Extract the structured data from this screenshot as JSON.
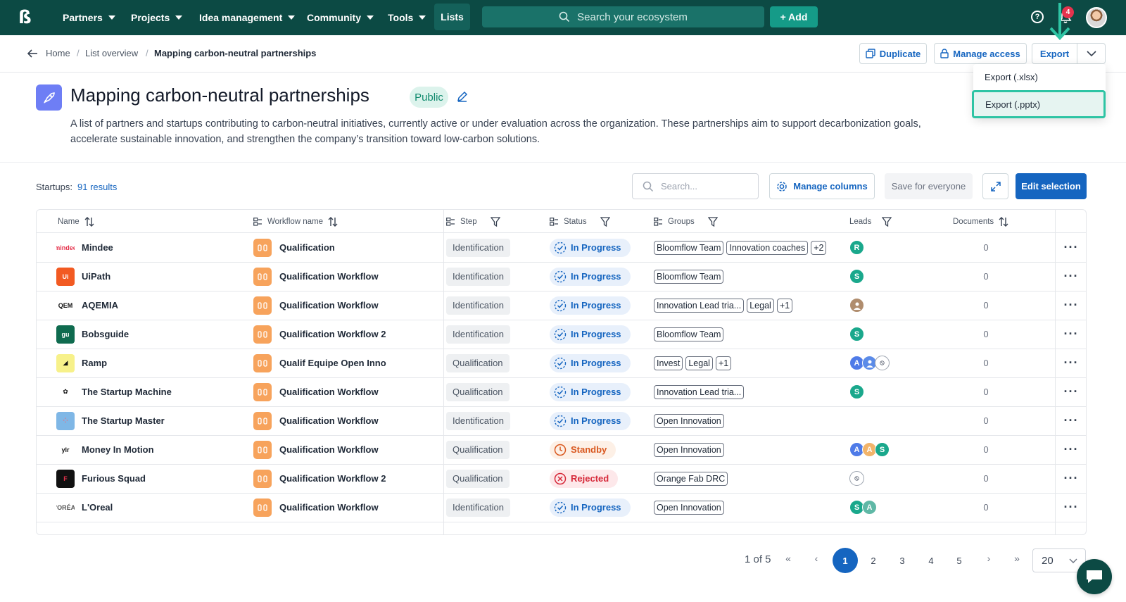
{
  "nav": {
    "items": [
      "Partners",
      "Projects",
      "Idea management",
      "Community",
      "Tools"
    ],
    "lists": "Lists",
    "search_placeholder": "Search your ecosystem",
    "add": "+ Add",
    "notifications_count": "4"
  },
  "breadcrumb": {
    "home": "Home",
    "overview": "List overview",
    "current": "Mapping carbon-neutral partnerships"
  },
  "actions": {
    "duplicate": "Duplicate",
    "manage_access": "Manage access",
    "export": "Export",
    "export_options": [
      "Export (.xlsx)",
      "Export (.pptx)"
    ]
  },
  "list": {
    "title": "Mapping carbon-neutral partnerships",
    "visibility": "Public",
    "description": "A list of partners and startups contributing to carbon-neutral initiatives, currently active or under evaluation across the organization. These partnerships aim to support decarbonization goals, accelerate sustainable innovation, and strengthen the company’s transition toward low-carbon solutions."
  },
  "toolbar": {
    "results_label": "Startups:",
    "results_count": "91 results",
    "search_placeholder": "Search...",
    "manage_columns": "Manage columns",
    "save_everyone": "Save for everyone",
    "edit_selection": "Edit selection"
  },
  "columns": [
    "Name",
    "Workflow name",
    "Step",
    "Status",
    "Groups",
    "Leads",
    "Documents"
  ],
  "rows": [
    {
      "name": "Mindee",
      "workflow": "Qualification",
      "step": "Identification",
      "status": "In Progress",
      "status_type": "progress",
      "groups": [
        "Bloomflow Team",
        "Innovation coaches",
        "+2"
      ],
      "leads": [
        {
          "t": "R",
          "c": "#1aa88c"
        }
      ],
      "docs": "0",
      "logo_text": "mindee",
      "logo_bg": "#ffffff",
      "logo_fg": "#e5334d"
    },
    {
      "name": "UiPath",
      "workflow": "Qualification Workflow",
      "step": "Identification",
      "status": "In Progress",
      "status_type": "progress",
      "groups": [
        "Bloomflow Team"
      ],
      "leads": [
        {
          "t": "S",
          "c": "#1aa88c"
        }
      ],
      "docs": "0",
      "logo_text": "Ui",
      "logo_bg": "#f25a22",
      "logo_fg": "#ffffff"
    },
    {
      "name": "AQEMIA",
      "workflow": "Qualification Workflow",
      "step": "Identification",
      "status": "In Progress",
      "status_type": "progress",
      "groups": [
        "Innovation Lead tria...",
        "Legal",
        "+1"
      ],
      "leads": [
        {
          "t": "",
          "c": "#b08d6e"
        }
      ],
      "docs": "0",
      "logo_text": "QEM",
      "logo_bg": "#ffffff",
      "logo_fg": "#111111"
    },
    {
      "name": "Bobsguide",
      "workflow": "Qualification Workflow 2",
      "step": "Identification",
      "status": "In Progress",
      "status_type": "progress",
      "groups": [
        "Bloomflow Team"
      ],
      "leads": [
        {
          "t": "S",
          "c": "#1aa88c"
        }
      ],
      "docs": "0",
      "logo_text": "gu",
      "logo_bg": "#0f6b4f",
      "logo_fg": "#ffffff"
    },
    {
      "name": "Ramp",
      "workflow": "Qualif Equipe Open Inno",
      "step": "Qualification",
      "status": "In Progress",
      "status_type": "progress",
      "groups": [
        "Invest",
        "Legal",
        "+1"
      ],
      "leads": [
        {
          "t": "A",
          "c": "#4f7be8"
        },
        {
          "t": "",
          "c": "#5b8be8"
        },
        {
          "t": "⦸",
          "c": "#ffffff"
        }
      ],
      "docs": "0",
      "logo_text": "◢",
      "logo_bg": "#f7f18a",
      "logo_fg": "#111111"
    },
    {
      "name": "The Startup Machine",
      "workflow": "Qualification Workflow",
      "step": "Qualification",
      "status": "In Progress",
      "status_type": "progress",
      "groups": [
        "Innovation Lead tria..."
      ],
      "leads": [
        {
          "t": "S",
          "c": "#1aa88c"
        }
      ],
      "docs": "0",
      "logo_text": "✿",
      "logo_bg": "#ffffff",
      "logo_fg": "#111111"
    },
    {
      "name": "The Startup Master",
      "workflow": "Qualification Workflow",
      "step": "Identification",
      "status": "In Progress",
      "status_type": "progress",
      "groups": [
        "Open Innovation"
      ],
      "leads": [],
      "docs": "0",
      "logo_text": "⁘",
      "logo_bg": "#7fb7e6",
      "logo_fg": "#f06a7a"
    },
    {
      "name": "Money In Motion",
      "workflow": "Qualification Workflow",
      "step": "Qualification",
      "status": "Standby",
      "status_type": "standby",
      "groups": [
        "Open Innovation"
      ],
      "leads": [
        {
          "t": "A",
          "c": "#4f7be8"
        },
        {
          "t": "A",
          "c": "#f2b46a"
        },
        {
          "t": "S",
          "c": "#1aa88c"
        }
      ],
      "docs": "0",
      "logo_text": "ylr",
      "logo_bg": "#ffffff",
      "logo_fg": "#111111"
    },
    {
      "name": "Furious Squad",
      "workflow": "Qualification Workflow 2",
      "step": "Qualification",
      "status": "Rejected",
      "status_type": "rejected",
      "groups": [
        "Orange Fab DRC"
      ],
      "leads": [
        {
          "t": "⦸",
          "c": "#ffffff"
        }
      ],
      "docs": "0",
      "logo_text": "F",
      "logo_bg": "#111111",
      "logo_fg": "#e5334d"
    },
    {
      "name": "L'Oreal",
      "workflow": "Qualification Workflow",
      "step": "Identification",
      "status": "In Progress",
      "status_type": "progress",
      "groups": [
        "Open Innovation"
      ],
      "leads": [
        {
          "t": "S",
          "c": "#1aa88c"
        },
        {
          "t": "A",
          "c": "#5fb8a6"
        }
      ],
      "docs": "0",
      "logo_text": "L'ORÉAL",
      "logo_bg": "#ffffff",
      "logo_fg": "#555555"
    }
  ],
  "pagination": {
    "info": "1 of 5",
    "pages": [
      "1",
      "2",
      "3",
      "4",
      "5"
    ],
    "active": "1",
    "page_size": "20"
  },
  "colors": {
    "brand_dark": "#0c4a44",
    "primary": "#1565c0",
    "highlight": "#2ec4a4"
  }
}
